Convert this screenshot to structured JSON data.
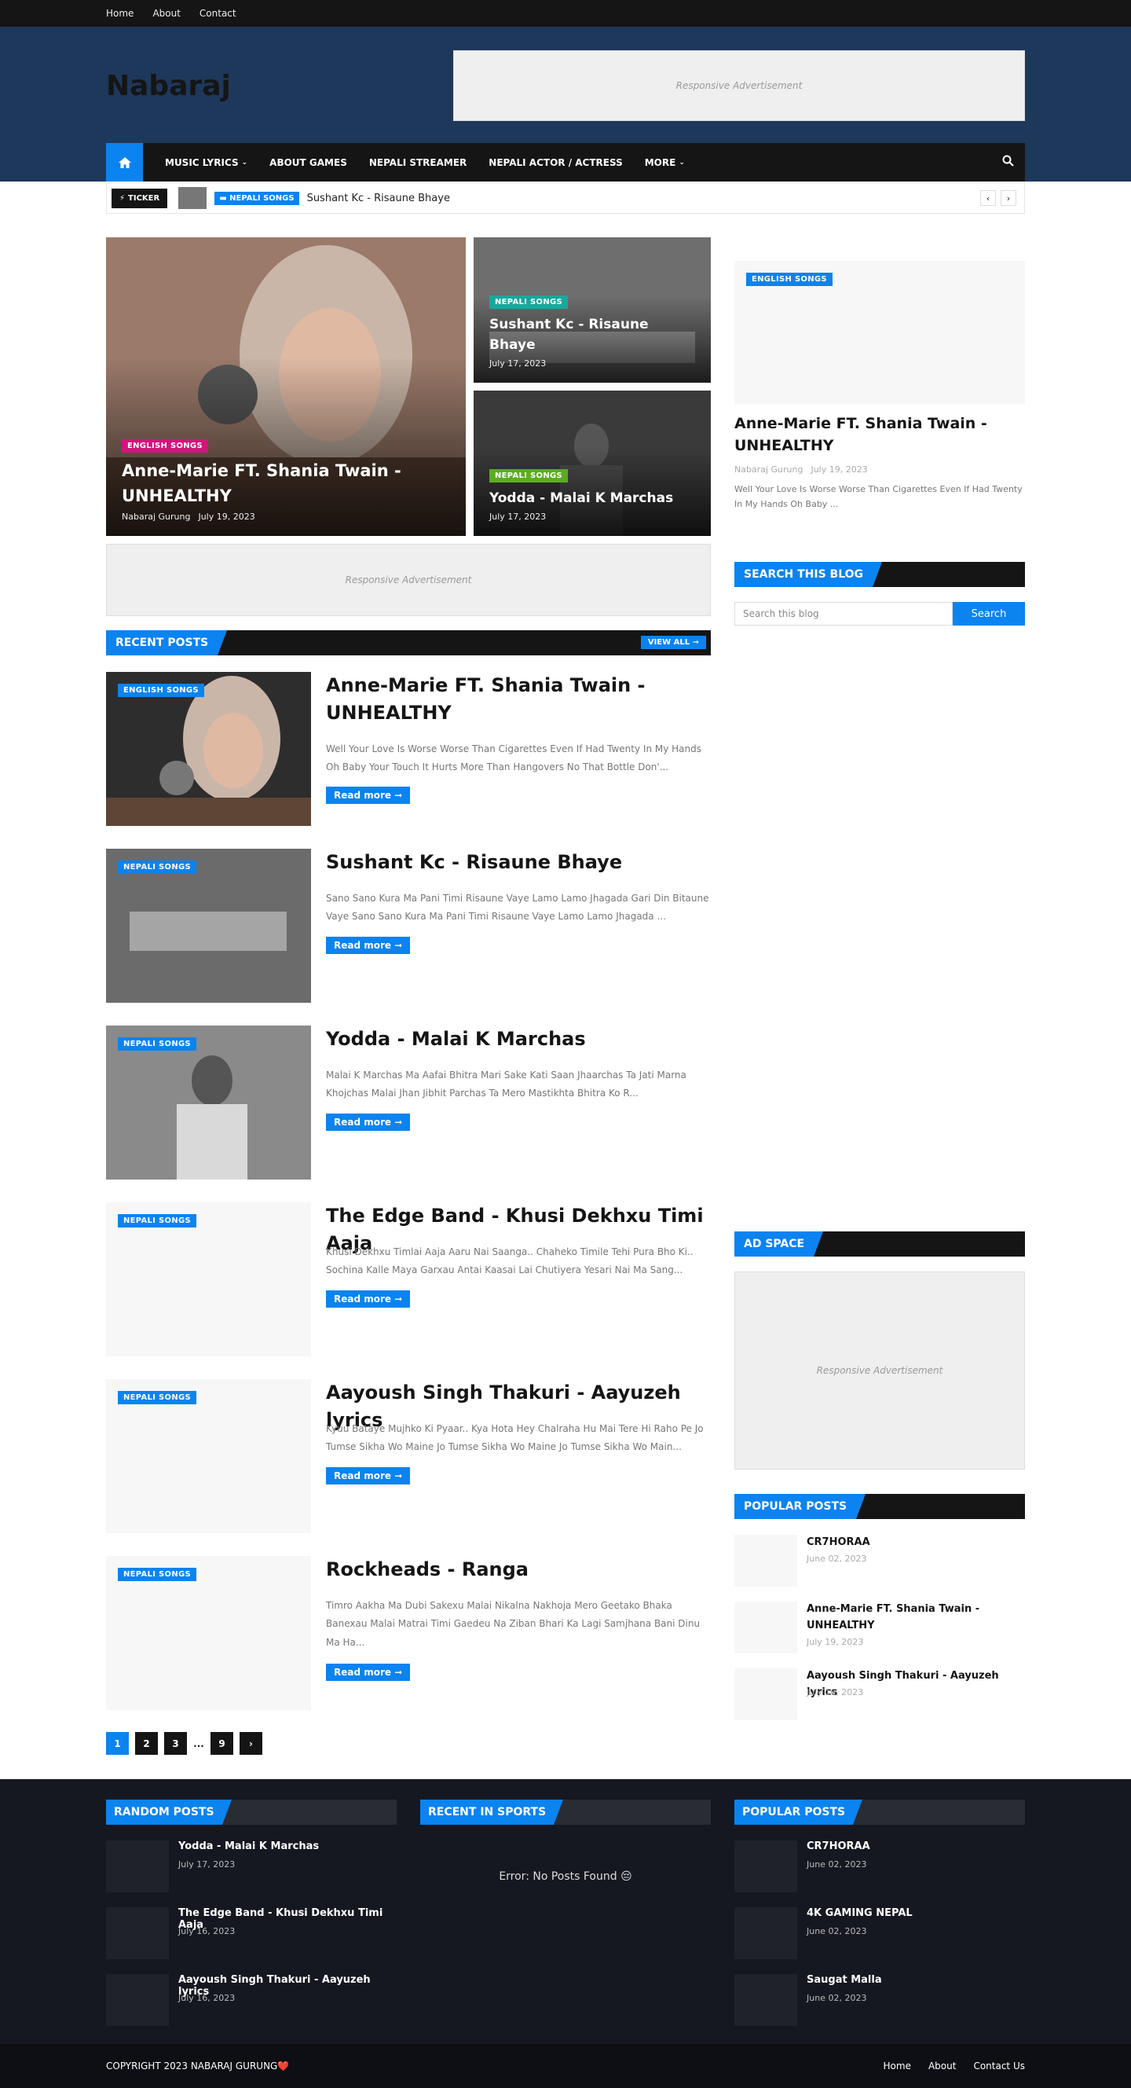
{
  "top_menu": [
    "Home",
    "About",
    "Contact"
  ],
  "site_title": "Nabaraj",
  "ads": {
    "label": "Responsive Advertisement"
  },
  "nav": {
    "items": [
      "MUSIC LYRICS",
      "ABOUT GAMES",
      "NEPALI STREAMER",
      "NEPALI ACTOR / ACTRESS",
      "MORE"
    ]
  },
  "ticker": {
    "label": "TICKER",
    "category": "NEPALI SONGS",
    "title": "Sushant Kc - Risaune Bhaye"
  },
  "featured": [
    {
      "category": "ENGLISH SONGS",
      "title": "Anne-Marie FT. Shania Twain - UNHEALTHY",
      "author": "Nabaraj Gurung",
      "date": "July 19, 2023"
    },
    {
      "category": "NEPALI SONGS",
      "title": "Sushant Kc - Risaune Bhaye",
      "date": "July 17, 2023"
    },
    {
      "category": "NEPALI SONGS",
      "title": "Yodda - Malai K Marchas",
      "date": "July 17, 2023"
    }
  ],
  "recent": {
    "heading": "RECENT POSTS",
    "view_all": "VIEW ALL",
    "read_more": "Read more",
    "posts": [
      {
        "category": "ENGLISH SONGS",
        "title": "Anne-Marie FT. Shania Twain - UNHEALTHY",
        "excerpt": "Well Your Love Is Worse Worse Than Cigarettes Even If Had Twenty In My Hands Oh Baby Your Touch It Hurts More Than Hangovers No That Bottle Don'..."
      },
      {
        "category": "NEPALI SONGS",
        "title": "Sushant Kc - Risaune Bhaye",
        "excerpt": "Sano Sano Kura  Ma  Pani Timi Risaune Vaye  Lamo Lamo Jhagada  Gari Din Bitaune Vaye  Sano Sano Kura  Ma  Pani Timi Risaune Vaye  Lamo Lamo Jhagada  ..."
      },
      {
        "category": "NEPALI SONGS",
        "title": "Yodda - Malai K Marchas",
        "excerpt": "Malai K Marchas      Ma Aafai Bhitra Mari Sake Kati Saan Jhaarchas Ta Jati Marna Khojchas Malai Jhan Jibhit Parchas Ta Mero Mastikhta Bhitra Ko  R..."
      },
      {
        "category": "NEPALI SONGS",
        "title": "The Edge Band - Khusi Dekhxu Timi Aaja",
        "excerpt": "Khusi Dekhxu Timlai Aaja Aaru Nai Saanga..  Chaheko Timile Tehi Pura Bho Ki.. Sochina Kalle Maya Garxau Antai Kaasai Lai Chutiyera Yesari Nai Ma Sang..."
      },
      {
        "category": "NEPALI SONGS",
        "title": "Aayoush Singh Thakuri - Aayuzeh lyrics",
        "excerpt": "Kyuu Bataye Mujhko  Ki Pyaar.. Kya Hota Hey  Chalraha Hu Mai Tere Hi Raho Pe Jo Tumse Sikha Wo Maine  Jo Tumse Sikha Wo Maine  Jo Tumse Sikha Wo Main..."
      },
      {
        "category": "NEPALI SONGS",
        "title": "Rockheads - Ranga",
        "excerpt": "Timro  Aakha  Ma  Dubi  Sakexu    Malai  Nikalna  Nakhoja  Mero  Geetako  Bhaka Banexau Malai Matrai Timi Gaedeu Na Ziban Bhari Ka Lagi Samjhana Bani Dinu Ma Ha..."
      }
    ]
  },
  "pagination": [
    "1",
    "2",
    "3",
    "...",
    "9"
  ],
  "sidebar": {
    "featured": {
      "category": "ENGLISH SONGS",
      "title": "Anne-Marie FT. Shania Twain - UNHEALTHY",
      "author": "Nabaraj Gurung",
      "date": "July 19, 2023",
      "excerpt": "Well Your Love Is Worse Worse Than Cigarettes Even If Had Twenty In My Hands Oh Baby ..."
    },
    "search_heading": "SEARCH THIS BLOG",
    "search_placeholder": "Search this blog",
    "search_button": "Search",
    "ad_heading": "AD SPACE",
    "popular_heading": "POPULAR POSTS",
    "popular": [
      {
        "title": "CR7HORAA",
        "date": "June 02, 2023"
      },
      {
        "title": "Anne-Marie FT. Shania Twain - UNHEALTHY",
        "date": "July 19, 2023"
      },
      {
        "title": "Aayoush Singh Thakuri - Aayuzeh lyrics",
        "date": "July 16, 2023"
      }
    ]
  },
  "footer": {
    "random_heading": "RANDOM POSTS",
    "random": [
      {
        "title": "Yodda - Malai K Marchas",
        "date": "July 17, 2023"
      },
      {
        "title": "The Edge Band - Khusi Dekhxu Timi Aaja",
        "date": "July 16, 2023"
      },
      {
        "title": "Aayoush Singh Thakuri - Aayuzeh lyrics",
        "date": "July 16, 2023"
      }
    ],
    "sports_heading": "RECENT IN SPORTS",
    "sports_error": "Error: No Posts Found 😔",
    "popular_heading": "POPULAR POSTS",
    "popular": [
      {
        "title": "CR7HORAA",
        "date": "June 02, 2023"
      },
      {
        "title": "4K GAMING NEPAL",
        "date": "June 02, 2023"
      },
      {
        "title": "Saugat Malla",
        "date": "June 02, 2023"
      }
    ],
    "copyright": "COPYRIGHT 2023 NABARAJ GURUNG❤️",
    "links": [
      "Home",
      "About",
      "Contact Us"
    ]
  },
  "colors": {
    "accent": "#0b83f0",
    "header_bg": "#1e385b",
    "dark": "#151515"
  }
}
